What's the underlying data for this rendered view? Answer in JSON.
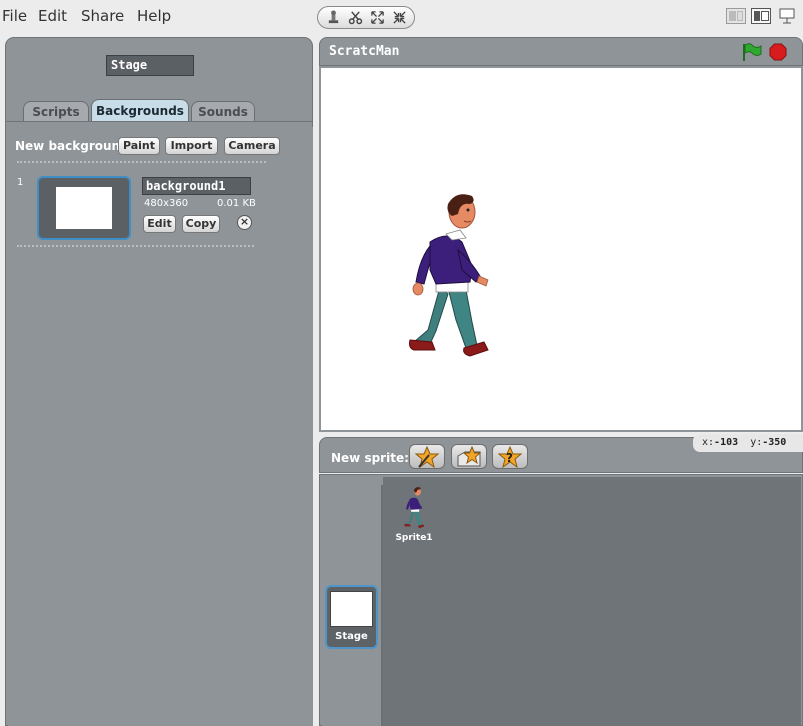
{
  "menu": {
    "items": [
      "File",
      "Edit",
      "Share",
      "Help"
    ]
  },
  "toolbar": {
    "tools": [
      "stamp-icon",
      "scissors-icon",
      "grow-icon",
      "shrink-icon"
    ],
    "view_modes": [
      "small-stage-mode-icon",
      "normal-stage-mode-icon",
      "presentation-mode-icon"
    ]
  },
  "left_panel": {
    "object_name": "Stage",
    "tabs": [
      {
        "label": "Scripts",
        "active": false
      },
      {
        "label": "Backgrounds",
        "active": true
      },
      {
        "label": "Sounds",
        "active": false
      }
    ],
    "new_background": {
      "label": "New background:",
      "buttons": [
        "Paint",
        "Import",
        "Camera"
      ]
    },
    "backgrounds": [
      {
        "index": "1",
        "name": "background1",
        "dimensions": "480x360",
        "size": "0.01 KB",
        "edit_label": "Edit",
        "copy_label": "Copy",
        "delete_symbol": "×"
      }
    ]
  },
  "stage": {
    "title": "ScratcMan",
    "colors": {
      "flag": "#2fa82f",
      "stop": "#d61c1c",
      "canvas": "#ffffff"
    }
  },
  "sprite_bar": {
    "label": "New sprite:",
    "tools": [
      "paint-sprite-icon",
      "import-sprite-icon",
      "surprise-sprite-icon"
    ]
  },
  "coords": {
    "x_label": "x:",
    "x_value": "-103",
    "y_label": "y:",
    "y_value": "-350"
  },
  "corral": {
    "stage_label": "Stage",
    "sprites": [
      {
        "name": "Sprite1"
      }
    ]
  },
  "theme": {
    "panel": "#8f9498",
    "selected_tab": "#c9dde8",
    "selection_border": "#3f8fc4"
  }
}
